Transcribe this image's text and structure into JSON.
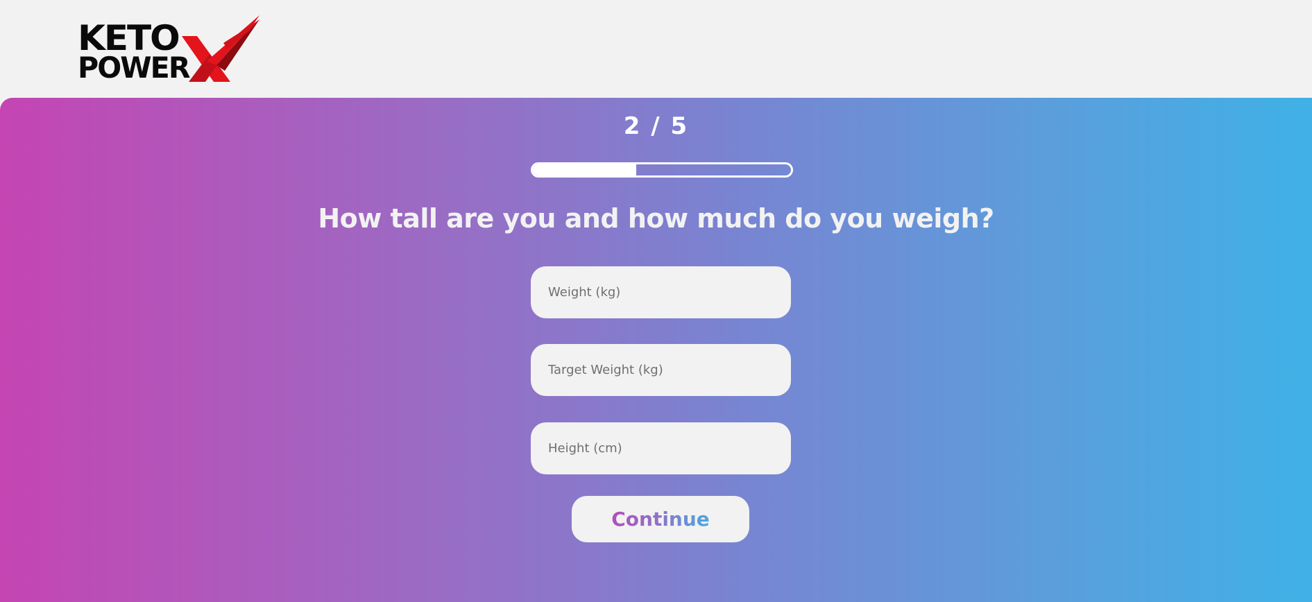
{
  "logo": {
    "line1": "KETO",
    "line2": "POWER",
    "mark_icon": "x-swoosh-icon",
    "colors": {
      "text": "#0a0a0a",
      "mark_light": "#e3141b",
      "mark_dark": "#7a0a0e"
    }
  },
  "quiz": {
    "step_label": "2 / 5",
    "progress_fraction": 0.4,
    "question": "How tall are you and how much do you weigh?"
  },
  "form": {
    "weight": {
      "value": "",
      "placeholder": "Weight (kg)"
    },
    "target_weight": {
      "value": "",
      "placeholder": "Target Weight (kg)"
    },
    "height": {
      "value": "",
      "placeholder": "Height (cm)"
    },
    "continue_label": "Continue"
  },
  "colors": {
    "page_bg": "#f2f2f2",
    "gradient_start": "#c445b3",
    "gradient_end": "#3fb1e6",
    "field_bg": "#f2f2f2"
  }
}
